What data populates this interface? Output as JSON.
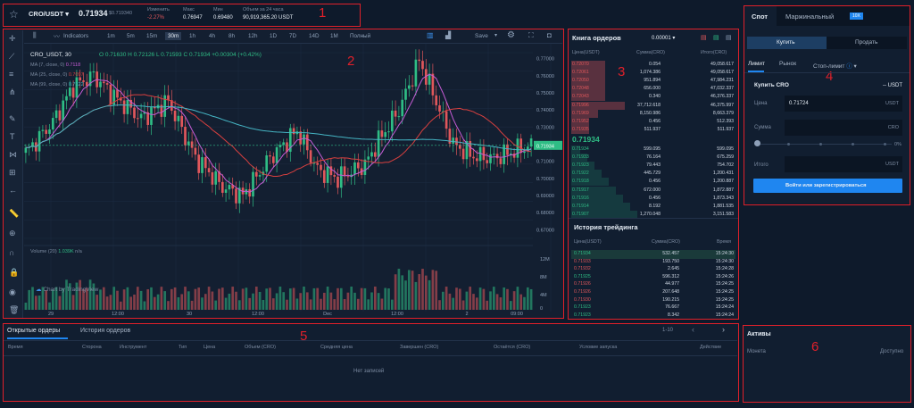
{
  "ticker": {
    "pair": "CRO/USDT",
    "price": "0.71934",
    "price_usd": "$0.719340",
    "change_label": "Изменить",
    "change_value": "-2.27%",
    "high_label": "Макс",
    "high_value": "0.76947",
    "low_label": "Мин",
    "low_value": "0.69480",
    "volume_label": "Объем за 24 часа",
    "volume_value": "90,919,365.20 USDT"
  },
  "chart_toolbar": {
    "indicators": "Indicators",
    "intervals": [
      "1m",
      "5m",
      "15m",
      "30m",
      "1h",
      "4h",
      "8h",
      "12h",
      "1D",
      "7D",
      "14D",
      "1M",
      "Полный"
    ],
    "active_interval": "30m",
    "save": "Save"
  },
  "chart_legend": {
    "symbol": "CRO_USDT, 30",
    "ohlc_o": "O 0.71630",
    "ohlc_h": "H 0.72126",
    "ohlc_l": "L 0.71593",
    "ohlc_c": "C 0.71934",
    "ohlc_chg": "+0.00304 (+0.42%)",
    "ma7": "MA (7, close, 0)",
    "ma7_val": "0.7118",
    "ma25": "MA (25, close, 0)",
    "ma25_val": "0.7097",
    "ma99": "MA (99, close, 0)",
    "ma99_val": "0.7122",
    "volume": "Volume (20)",
    "volume_val": "1.039K",
    "volume_na": "n/a",
    "watermark": "Chart by TradingView",
    "price_axis": [
      "0.77000",
      "0.76000",
      "0.75000",
      "0.74000",
      "0.73000",
      "0.72000",
      "0.71000",
      "0.70000",
      "0.69000",
      "0.68000",
      "0.67000"
    ],
    "current_price_tag": "0.71934",
    "vol_axis": [
      "12M",
      "8M",
      "4M",
      "0"
    ],
    "time_axis": [
      "29",
      "12:00",
      "30",
      "12:00",
      "Dec",
      "12:00",
      "2",
      "09:00"
    ]
  },
  "orderbook": {
    "title": "Книга ордеров",
    "precision": "0.00001",
    "col_price": "Цена(USDT)",
    "col_amount": "Сумма(CRO)",
    "col_total": "Итого(CRO)",
    "asks": [
      [
        "0.72070",
        "0.054",
        "49,058.617"
      ],
      [
        "0.72061",
        "1,074.386",
        "49,058.617"
      ],
      [
        "0.72050",
        "951.894",
        "47,984.231"
      ],
      [
        "0.72048",
        "656.000",
        "47,032.337"
      ],
      [
        "0.72043",
        "0.340",
        "46,376.337"
      ],
      [
        "0.71996",
        "37,712.618",
        "46,375.997"
      ],
      [
        "0.71969",
        "8,150.986",
        "8,663.379"
      ],
      [
        "0.71952",
        "0.456",
        "512.393"
      ],
      [
        "0.71935",
        "511.937",
        "511.937"
      ]
    ],
    "mid_price": "0.71934",
    "bids": [
      [
        "0.71934",
        "599.095",
        "599.095"
      ],
      [
        "0.71933",
        "76.164",
        "675.259"
      ],
      [
        "0.71923",
        "79.443",
        "754.702"
      ],
      [
        "0.71922",
        "445.729",
        "1,200.431"
      ],
      [
        "0.71918",
        "0.456",
        "1,200.887"
      ],
      [
        "0.71917",
        "672.000",
        "1,872.887"
      ],
      [
        "0.71916",
        "0.456",
        "1,873.343"
      ],
      [
        "0.71914",
        "8.192",
        "1,881.535"
      ],
      [
        "0.71907",
        "1,270.048",
        "3,151.583"
      ]
    ]
  },
  "trades": {
    "title": "История трейдинга",
    "col_price": "Цена(USDT)",
    "col_amount": "Сумма(CRO)",
    "col_time": "Время",
    "rows": [
      [
        "0.71934",
        "532.457",
        "15:24:30",
        "g"
      ],
      [
        "0.71933",
        "193.750",
        "15:24:30",
        "r"
      ],
      [
        "0.71932",
        "2.645",
        "15:24:28",
        "r"
      ],
      [
        "0.71925",
        "596.312",
        "15:24:26",
        "g"
      ],
      [
        "0.71926",
        "44.977",
        "15:24:25",
        "r"
      ],
      [
        "0.71926",
        "207.648",
        "15:24:25",
        "r"
      ],
      [
        "0.71930",
        "190.215",
        "15:24:25",
        "r"
      ],
      [
        "0.71923",
        "76.667",
        "15:24:24",
        "g"
      ],
      [
        "0.71923",
        "8.342",
        "15:24:24",
        "g"
      ]
    ]
  },
  "trade_panel": {
    "tab_spot": "Спот",
    "tab_margin": "Маржинальный",
    "margin_badge": "10X",
    "buy": "Купить",
    "sell": "Продать",
    "type_limit": "Лимит",
    "type_market": "Рынок",
    "type_stop": "Стоп-лимит",
    "buy_title": "Купить CRO",
    "balance": "-- USDT",
    "price_label": "Цена",
    "price_value": "0.71724",
    "price_unit": "USDT",
    "amount_label": "Сумма",
    "amount_unit": "CRO",
    "slider_pct": "0%",
    "slider_level": 0,
    "total_label": "Итого",
    "total_unit": "USDT",
    "login_button": "Войти или зарегистрироваться"
  },
  "orders": {
    "tab_open": "Открытые ордеры",
    "tab_history": "История ордеров",
    "pagination": "1-10",
    "columns": [
      "Время",
      "Сторона",
      "Инструмент",
      "Тип",
      "Цена",
      "Объем (CRO)",
      "Средняя цена",
      "Завершен (CRO)",
      "Остаётся (CRO)",
      "Условие запуска",
      "Действие"
    ],
    "empty": "Нет записей"
  },
  "assets": {
    "title": "Активы",
    "col_coin": "Монета",
    "col_available": "Доступно"
  },
  "annotations": [
    "1",
    "2",
    "3",
    "4",
    "5",
    "6"
  ],
  "colors": {
    "accent": "#1f86f0",
    "up": "#2fbd85",
    "down": "#e0575b",
    "annotation": "#e0202a"
  }
}
